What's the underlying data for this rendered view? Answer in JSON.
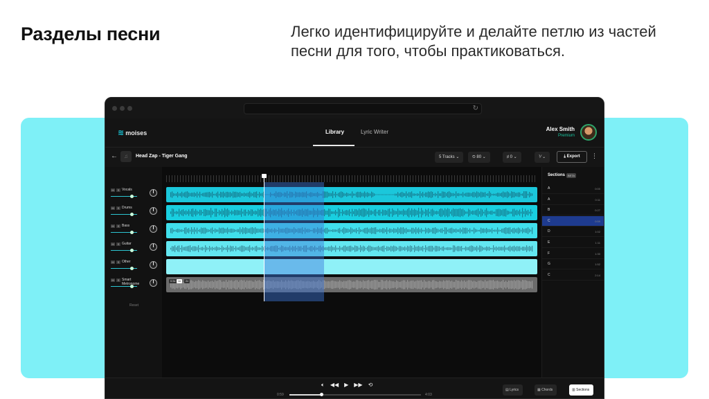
{
  "slide": {
    "heading": "Разделы песни",
    "description": "Легко идентифицируйте и делайте петлю из частей песни для того, чтобы практиковаться."
  },
  "colors": {
    "band": "#7ef0f7",
    "accent": "#19c6d8",
    "selection": "#1e3b8f"
  },
  "app": {
    "logo": "moises",
    "nav": {
      "tabs": [
        "Library",
        "Lyric Writer"
      ],
      "active": "Library"
    },
    "user": {
      "name": "Alex Smith",
      "plan": "Premium"
    },
    "song": {
      "title": "Head Zap - Tiger Gang",
      "tracks_label": "5 Tracks",
      "bpm": "80",
      "pitch": "0",
      "meter": "12\n34",
      "export_label": "Export"
    },
    "tracks": [
      {
        "label": "Vocals",
        "color": "#1bc7db",
        "level": 0.8
      },
      {
        "label": "Drums",
        "color": "#19cfe0",
        "level": 0.8
      },
      {
        "label": "Bass",
        "color": "#40dfeb",
        "level": 0.8
      },
      {
        "label": "Guitar",
        "color": "#63e7f1",
        "level": 0.8
      },
      {
        "label": "Other",
        "color": "#8ff1f7",
        "level": 0.8
      },
      {
        "label": "Smart\nMetronome",
        "color": "#6b6b6b",
        "level": 0.8
      }
    ],
    "metronome_chips": [
      "0.5x",
      "1x",
      "2x"
    ],
    "reset_label": "Reset",
    "sections_panel": {
      "title": "Sections",
      "badge": "BETA",
      "items": [
        {
          "label": "A",
          "time": "0:00"
        },
        {
          "label": "A",
          "time": "0:11"
        },
        {
          "label": "B",
          "time": "0:27"
        },
        {
          "label": "C",
          "time": "0:59",
          "active": true
        },
        {
          "label": "D",
          "time": "1:02"
        },
        {
          "label": "E",
          "time": "1:11"
        },
        {
          "label": "F",
          "time": "1:30"
        },
        {
          "label": "G",
          "time": "1:52"
        },
        {
          "label": "C",
          "time": "2:14"
        }
      ]
    },
    "player": {
      "current": "0:59",
      "total": "4:03",
      "progress": 0.24,
      "icons": [
        "volume-icon",
        "rewind-icon",
        "play-icon",
        "forward-icon",
        "loop-icon"
      ]
    },
    "bottom_buttons": [
      "Lyrics",
      "Chords",
      "Sections"
    ],
    "bottom_active": "Sections"
  }
}
